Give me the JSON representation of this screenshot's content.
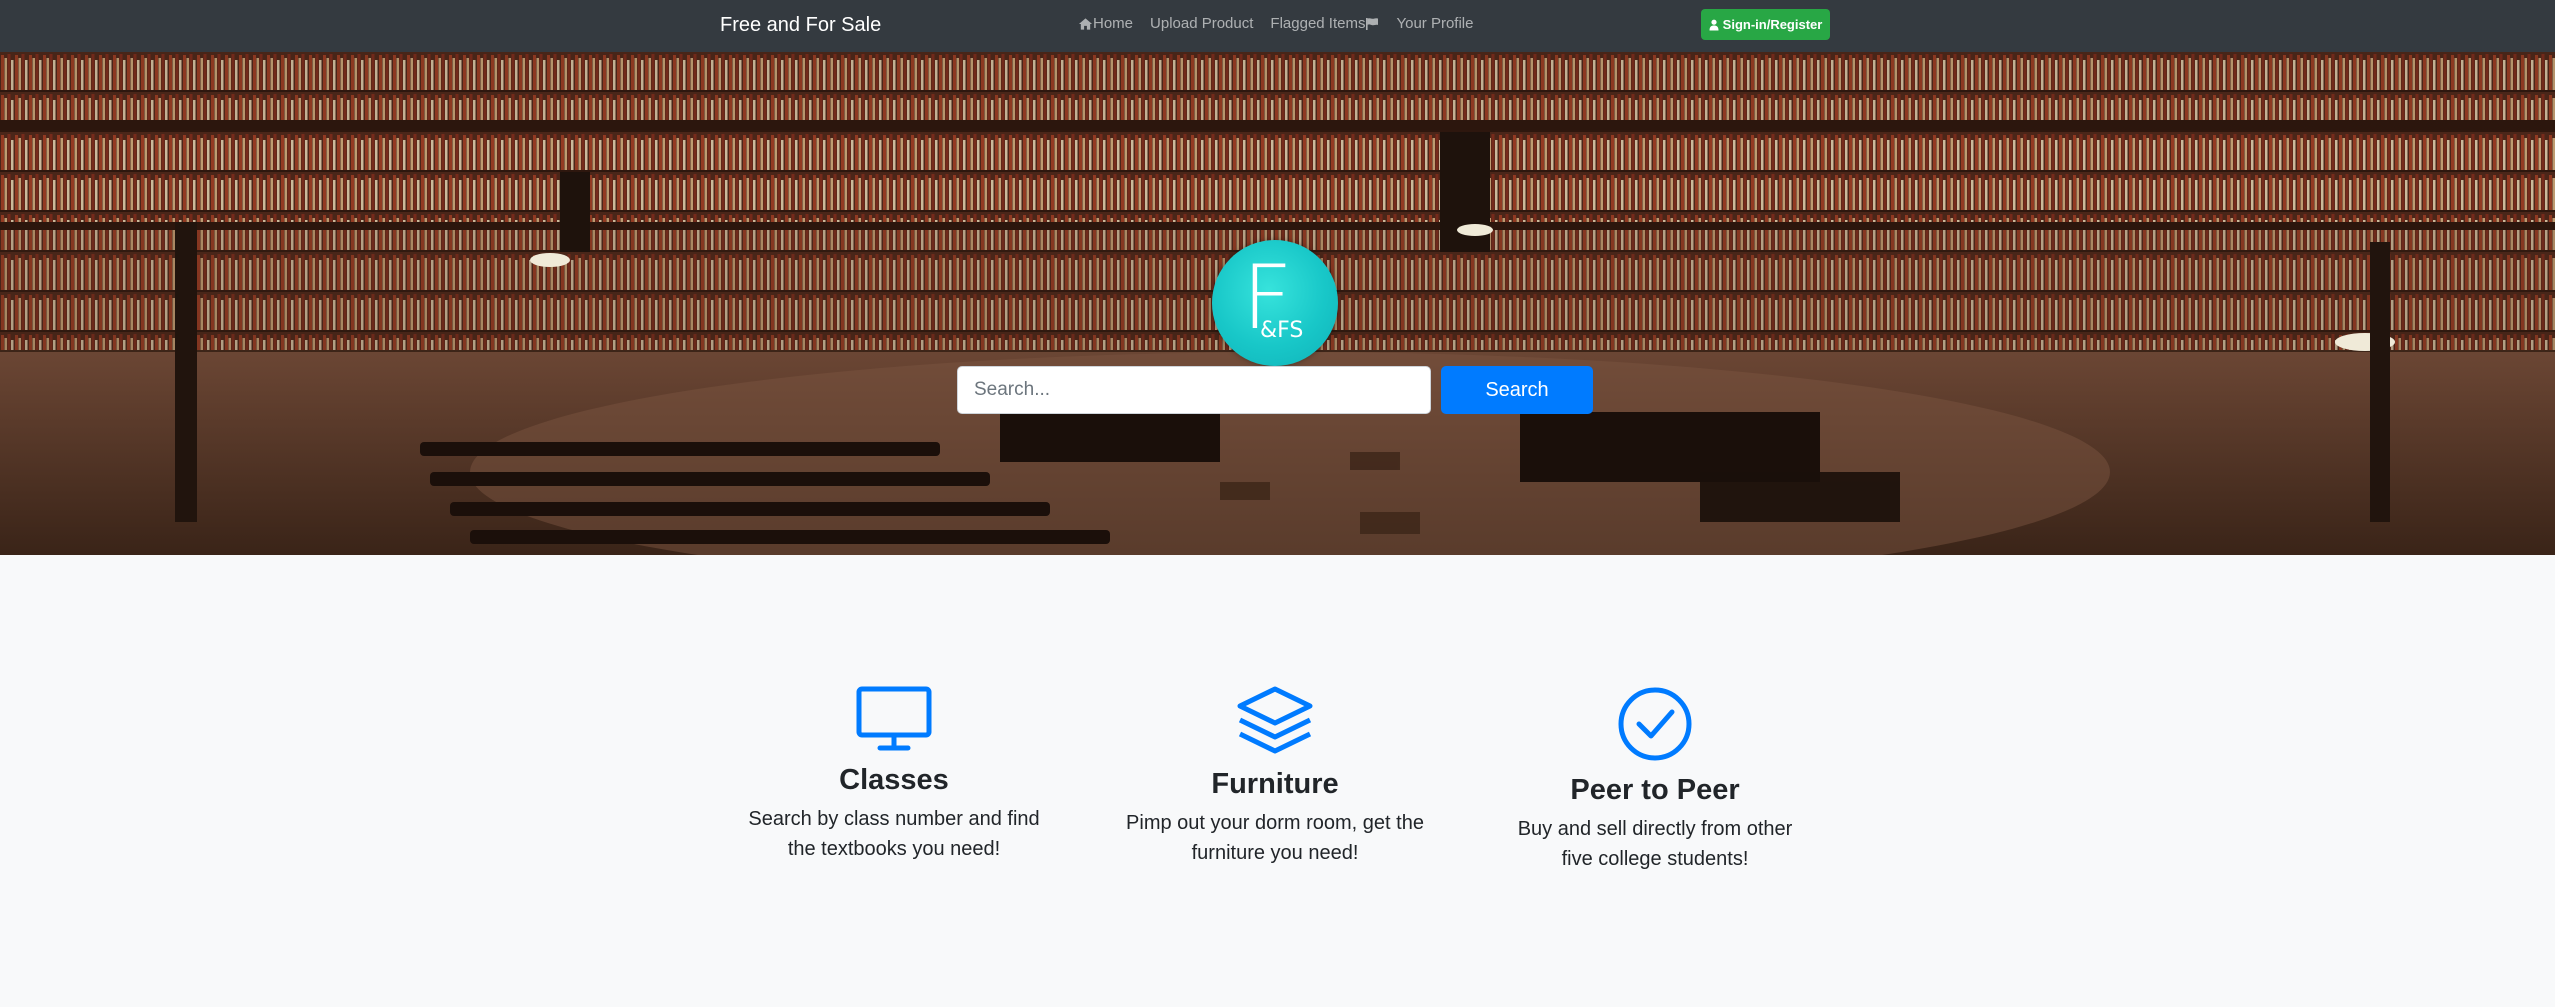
{
  "navbar": {
    "brand": "Free and For Sale",
    "links": [
      {
        "label": "Home",
        "icon": "home-icon"
      },
      {
        "label": "Upload Product",
        "icon": ""
      },
      {
        "label": "Flagged Items",
        "icon": "flag-icon"
      },
      {
        "label": "Your Profile",
        "icon": ""
      }
    ],
    "signin_label": "Sign-in/Register",
    "signin_icon": "user-icon"
  },
  "hero": {
    "logo_main": "F",
    "logo_sub": "&FS",
    "search_placeholder": "Search...",
    "search_button": "Search"
  },
  "features": [
    {
      "icon": "monitor-icon",
      "title": "Classes",
      "text": "Search by class number and find the textbooks you need!"
    },
    {
      "icon": "layers-icon",
      "title": "Furniture",
      "text": "Pimp out your dorm room, get the furniture you need!"
    },
    {
      "icon": "check-circle-icon",
      "title": "Peer to Peer",
      "text": "Buy and sell directly from other five college students!"
    }
  ],
  "colors": {
    "navbar_bg": "#343a40",
    "accent_blue": "#007bff",
    "signin_green": "#28a745",
    "logo_teal": "#18c7c8",
    "page_bg": "#f8f9fa"
  }
}
